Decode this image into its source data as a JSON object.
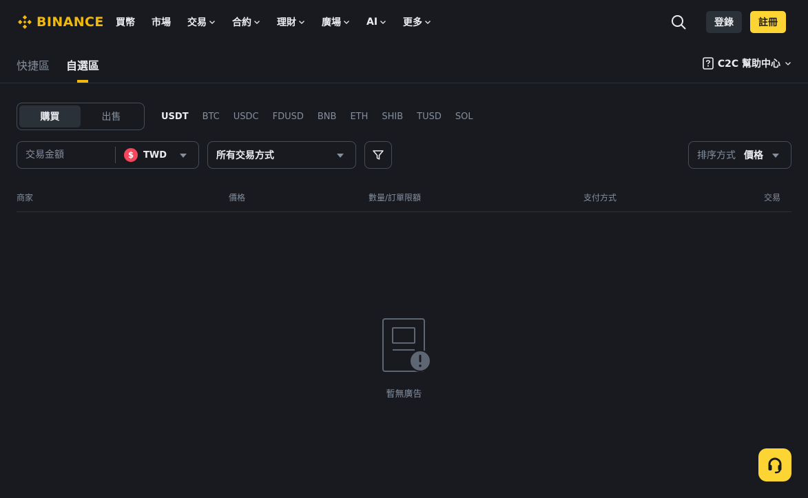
{
  "brand": {
    "name": "BINANCE",
    "accent": "#f0b90b"
  },
  "nav": {
    "items": [
      {
        "label": "買幣",
        "has_dropdown": false
      },
      {
        "label": "市場",
        "has_dropdown": false
      },
      {
        "label": "交易",
        "has_dropdown": true
      },
      {
        "label": "合約",
        "has_dropdown": true
      },
      {
        "label": "理財",
        "has_dropdown": true
      },
      {
        "label": "廣場",
        "has_dropdown": true
      },
      {
        "label": "AI",
        "has_dropdown": true
      },
      {
        "label": "更多",
        "has_dropdown": true
      }
    ],
    "login_label": "登錄",
    "register_label": "註冊"
  },
  "subtabs": [
    {
      "label": "快捷區",
      "active": false
    },
    {
      "label": "自選區",
      "active": true
    }
  ],
  "help": {
    "label": "C2C 幫助中心"
  },
  "trade_toggle": {
    "buy_label": "購買",
    "sell_label": "出售",
    "active": "buy"
  },
  "coins": [
    "USDT",
    "BTC",
    "USDC",
    "FDUSD",
    "BNB",
    "ETH",
    "SHIB",
    "TUSD",
    "SOL"
  ],
  "active_coin": "USDT",
  "filters": {
    "amount_placeholder": "交易金額",
    "fiat": "TWD",
    "fiat_symbol": "$",
    "payment_method": "所有交易方式",
    "sort_label": "排序方式",
    "sort_value": "價格"
  },
  "table": {
    "headers": {
      "merchant": "商家",
      "price": "價格",
      "limit": "數量/訂單限額",
      "payment": "支付方式",
      "trade": "交易"
    }
  },
  "empty_state": {
    "text": "暫無廣告"
  },
  "colors": {
    "background": "#181a20",
    "panel": "#2b3139",
    "border": "#474d57",
    "muted": "#848e9c",
    "yellow_button": "#fcd535",
    "fiat_red": "#f6465d"
  }
}
